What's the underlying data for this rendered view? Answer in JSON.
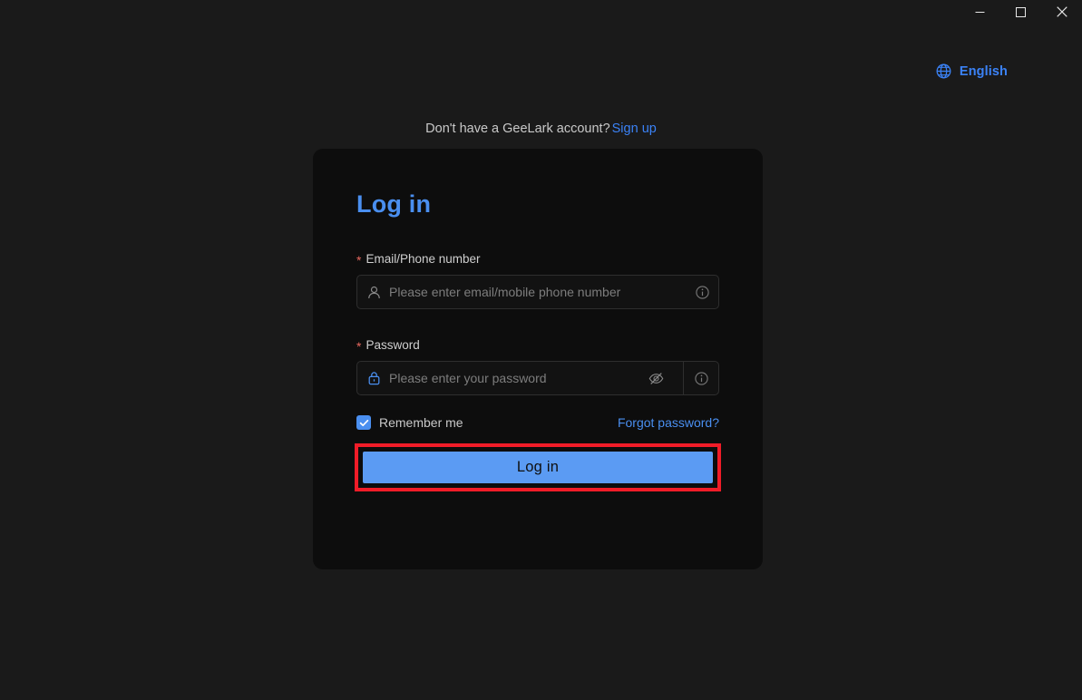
{
  "window": {
    "controls": [
      {
        "name": "minimize",
        "icon": "minimize-icon",
        "tooltip": "Minimize"
      },
      {
        "name": "maximize",
        "icon": "maximize-icon",
        "tooltip": "Maximize"
      },
      {
        "name": "close",
        "icon": "close-icon",
        "tooltip": "Close"
      }
    ]
  },
  "language": {
    "icon": "globe-icon",
    "label": "English",
    "accent": "#3b82f6"
  },
  "signup": {
    "prompt": "Don't have a GeeLark account?",
    "link_label": "Sign up"
  },
  "card": {
    "title": "Log in",
    "background": "#0d0d0d",
    "title_color": "#4a8ff0",
    "fields": [
      {
        "label": "Email/Phone number",
        "required_marker": "*",
        "value": "",
        "placeholder": "Please enter email/mobile phone number",
        "lead_icon": "person-icon",
        "trail_icon": "info-circle-icon"
      },
      {
        "label": "Password",
        "required_marker": "*",
        "value": "",
        "placeholder": "Please enter your password",
        "lead_icon": "lock-icon",
        "toggle_icon": "eye-off-icon",
        "trail_icon": "info-circle-icon"
      }
    ],
    "remember_me": {
      "label": "Remember me",
      "checked": true,
      "checkbox_color": "#4a8ff0"
    },
    "forgot_password_label": "Forgot password?",
    "submit": {
      "label": "Log in",
      "color": "#5b9bf3",
      "highlight_color": "#f01c28"
    }
  },
  "page": {
    "background": "#1a1a1a"
  }
}
